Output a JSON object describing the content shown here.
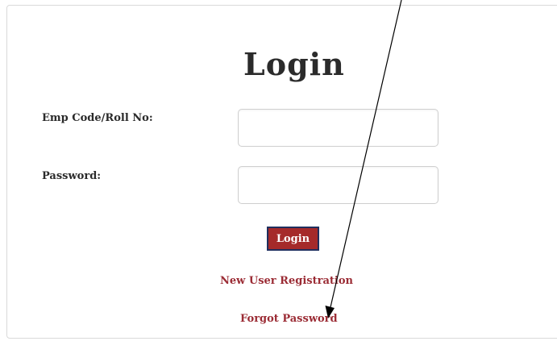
{
  "login": {
    "title": "Login",
    "emp_label": "Emp Code/Roll No:",
    "emp_value": "",
    "password_label": "Password:",
    "password_value": "",
    "button_label": "Login",
    "register_link": "New User Registration",
    "forgot_link": "Forgot Password"
  },
  "colors": {
    "button_bg": "#a52a2a",
    "button_border": "#1f2f5e",
    "link": "#9b2c35"
  }
}
